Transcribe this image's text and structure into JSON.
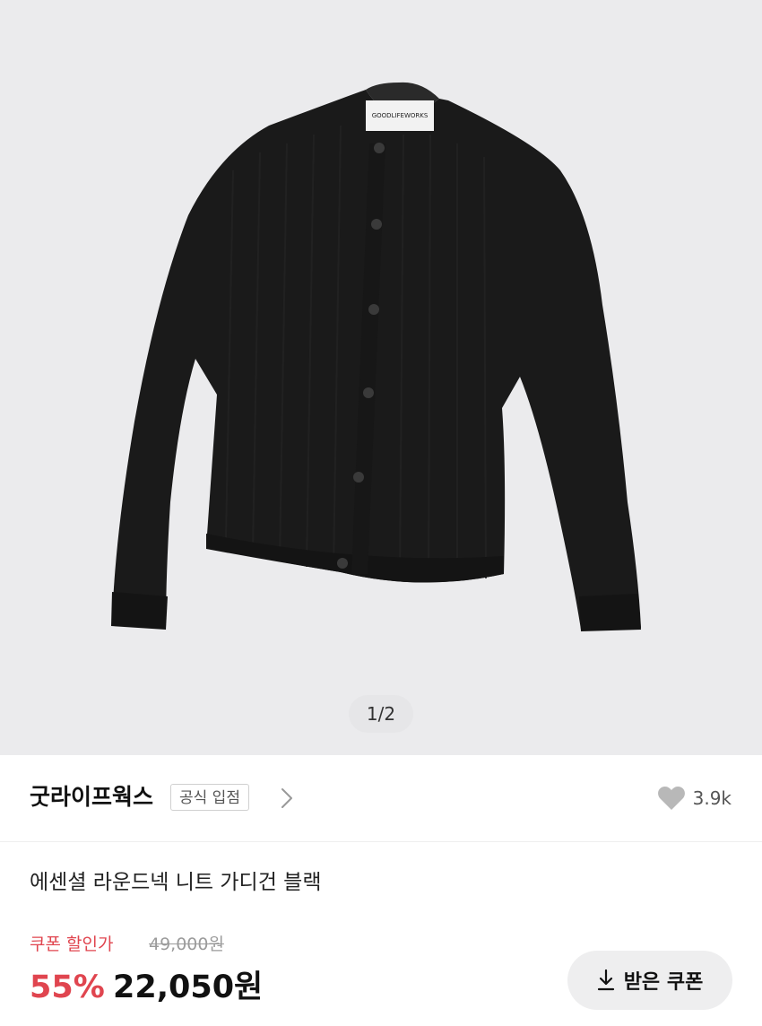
{
  "gallery": {
    "pager_text": "1/2",
    "label_brand_text": "GOODLIFEWORKS"
  },
  "brand": {
    "name": "굿라이프웍스",
    "badge": "공식 입점"
  },
  "like": {
    "count": "3.9k",
    "icon": "heart-icon"
  },
  "product": {
    "title": "에센셜 라운드넥 니트 가디건 블랙"
  },
  "price": {
    "coupon_label": "쿠폰 할인가",
    "original_price": "49,000원",
    "discount_rate": "55%",
    "final_price": "22,050원"
  },
  "coupon_button": {
    "label": "받은 쿠폰",
    "icon": "download-icon"
  },
  "colors": {
    "accent_red": "#e0454f",
    "hero_bg": "#ebebed",
    "button_bg": "#eeeeef"
  }
}
